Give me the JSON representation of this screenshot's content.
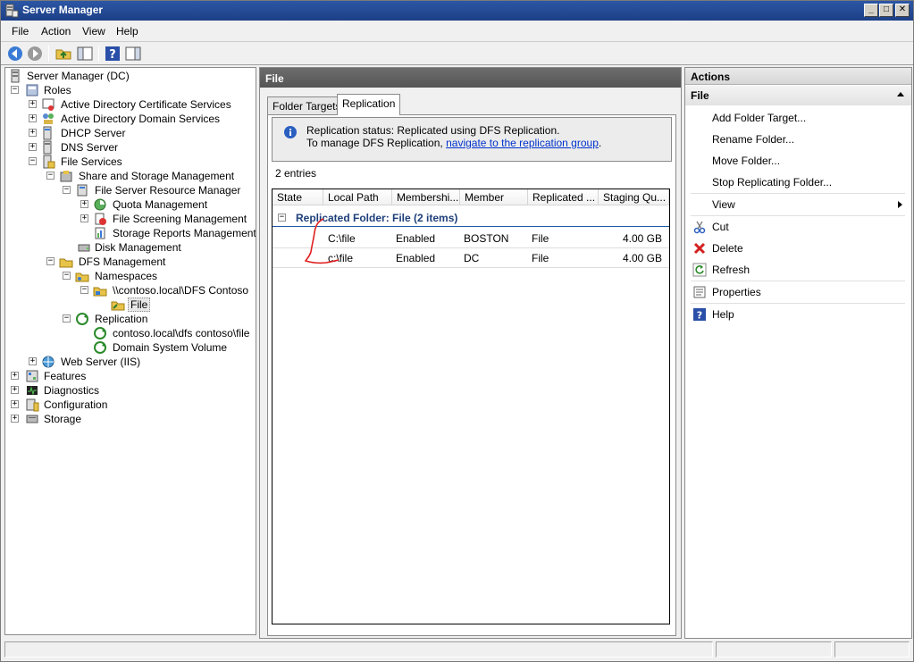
{
  "window": {
    "title": "Server Manager"
  },
  "window_buttons": {
    "minimize": "_",
    "maximize": "□",
    "close": "✕"
  },
  "menu": [
    "File",
    "Action",
    "View",
    "Help"
  ],
  "toolbar": {
    "buttons": [
      "back-icon",
      "forward-icon",
      "up-folder-icon",
      "show-hide-tree-icon",
      "help-icon",
      "properties-pane-icon"
    ]
  },
  "tree": {
    "root": "Server Manager (DC)",
    "roles": "Roles",
    "ad_cert": "Active Directory Certificate Services",
    "ad_domain": "Active Directory Domain Services",
    "dhcp": "DHCP Server",
    "dns": "DNS Server",
    "file_services": "File Services",
    "share_storage": "Share and Storage Management",
    "fsrm": "File Server Resource Manager",
    "quota": "Quota Management",
    "file_screening": "File Screening Management",
    "storage_reports": "Storage Reports Management",
    "disk_mgmt": "Disk Management",
    "dfs_mgmt": "DFS Management",
    "namespaces": "Namespaces",
    "dfs_contoso": "\\\\contoso.local\\DFS Contoso",
    "file": "File",
    "replication": "Replication",
    "repl_group": "contoso.local\\dfs contoso\\file",
    "domain_system_volume": "Domain System Volume",
    "web_server": "Web Server (IIS)",
    "features": "Features",
    "diagnostics": "Diagnostics",
    "configuration": "Configuration",
    "storage": "Storage",
    "expand_symbol": "+",
    "collapse_symbol": "−"
  },
  "center": {
    "header": "File",
    "tabs": [
      "Folder Targets",
      "Replication"
    ],
    "status_line1": "Replication status: Replicated using DFS Replication.",
    "status_line2_prefix": "To manage DFS Replication,",
    "status_link": "navigate to the replication group",
    "status_line2_suffix": ".",
    "entries": "2 entries",
    "columns": [
      "State",
      "Local Path",
      "Membershi...",
      "Member",
      "Replicated ...",
      "Staging Qu..."
    ],
    "group_label": "Replicated Folder: File (2 items)",
    "rows": [
      {
        "state": "",
        "path": "C:\\file",
        "membership": "Enabled",
        "member": "BOSTON",
        "replicated": "File",
        "staging": "4.00 GB"
      },
      {
        "state": "",
        "path": "c:\\file",
        "membership": "Enabled",
        "member": "DC",
        "replicated": "File",
        "staging": "4.00 GB"
      }
    ]
  },
  "actions": {
    "header": "Actions",
    "section": "File",
    "items": [
      "Add Folder Target...",
      "Rename Folder...",
      "Move Folder...",
      "Stop Replicating Folder...",
      "View",
      "Cut",
      "Delete",
      "Refresh",
      "Properties",
      "Help"
    ]
  },
  "annotation": {
    "color": "#e02020"
  }
}
